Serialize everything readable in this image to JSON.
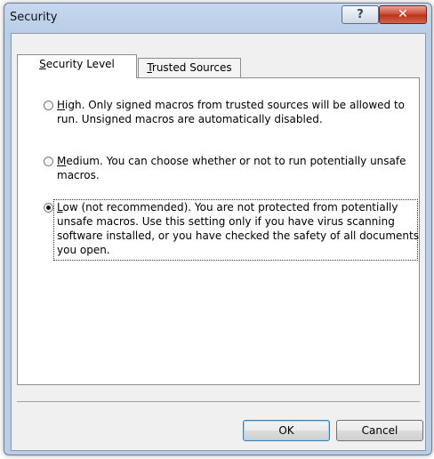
{
  "window": {
    "title": "Security",
    "help_glyph": "?",
    "close_glyph": "✕"
  },
  "tabs": [
    {
      "label": "Security Level",
      "access_key": "S",
      "rest": "ecurity Level",
      "active": true
    },
    {
      "label": "Trusted Sources",
      "access_key": "T",
      "rest": "rusted Sources",
      "active": false
    }
  ],
  "options": [
    {
      "access_key": "H",
      "rest": "igh. Only signed macros from trusted sources will be allowed to run. Unsigned macros are automatically disabled.",
      "selected": false
    },
    {
      "access_key": "M",
      "rest": "edium. You can choose whether or not to run potentially unsafe macros.",
      "selected": false
    },
    {
      "access_key": "L",
      "rest": "ow (not recommended). You are not protected from potentially unsafe macros. Use this setting only if you have virus scanning software installed, or you have checked the safety of all documents you open.",
      "selected": true
    }
  ],
  "buttons": {
    "ok": "OK",
    "cancel": "Cancel"
  },
  "colors": {
    "frame": "#b9cde8",
    "close_button": "#c9452e",
    "panel": "#ffffff"
  }
}
